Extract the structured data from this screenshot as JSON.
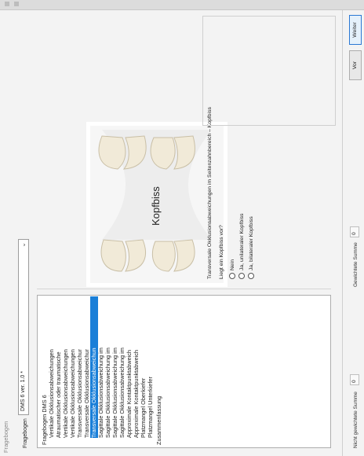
{
  "window": {
    "title": "Fragebogen"
  },
  "fragebogen": {
    "label": "Fragebogen",
    "selected": "DMS 6 ver. 1.0 *"
  },
  "tree": {
    "root": "Fragebogen DMS 6",
    "items": [
      "Vertikale Okklusionsabweichungen",
      "Atraumatischer oder traumatische",
      "Vertikale Okklusionsabweichungen",
      "Vertikale Okklusionsabweichungen",
      "Transversale Okklusionsabweichur",
      "Transversale Okklusionsabweichur",
      "Transversale Okklusionsabweichun",
      "Sagittale Okklusionsabweichung im",
      "Sagittale Okklusionsabweichung im",
      "Sagittale Okklusionsabweichung im",
      "Sagittale Okklusionsabweichung im",
      "Approximale Kontaktpunktabweich",
      "Approximale Kontaktpunktabweich",
      "Platzmangel Oberkiefer",
      "Platzmangel Unterkiefer"
    ],
    "selected_index": 6,
    "summary": "Zusammenfassung"
  },
  "image": {
    "caption": "Kopfbiss"
  },
  "question": {
    "title": "Transversale Okklusionsabweichungen im Seitenzahnbereich – Kopfbiss",
    "prompt": "Liegt ein Kopfbiss vor?",
    "options": [
      "Nein",
      "Ja, unilateraler Kopfbiss",
      "Ja, bilateraler Kopfbiss"
    ],
    "selected_index": null
  },
  "footer": {
    "unweighted_label": "Nicht gewichtete Summe",
    "unweighted_value": "0",
    "weighted_label": "Gewichtete Summe",
    "weighted_value": "0",
    "back": "Vor",
    "next": "Weiter"
  }
}
